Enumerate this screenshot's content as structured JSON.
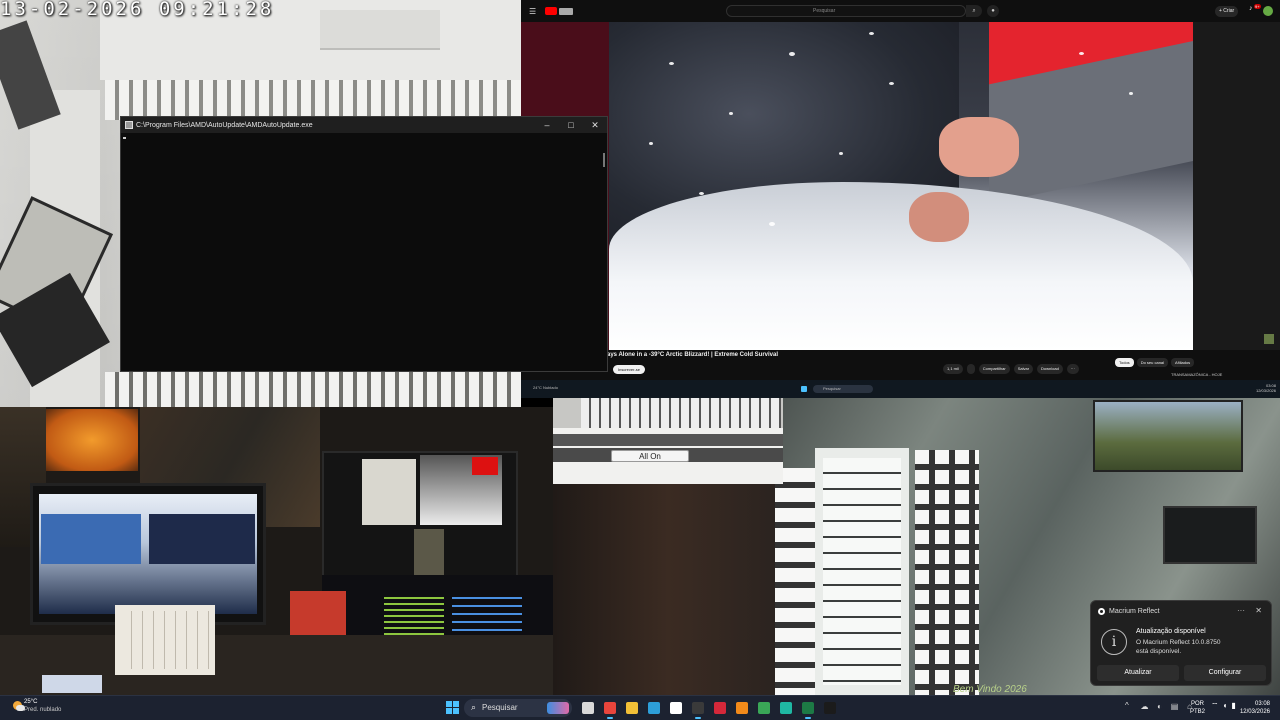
{
  "camera_top_left": {
    "timestamp": "13-02-2026 09:21:28"
  },
  "console_window": {
    "title": "C:\\Program Files\\AMD\\AutoUpdate\\AMDAutoUpdate.exe",
    "minimize": "–",
    "maximize": "□",
    "close": "✕"
  },
  "youtube": {
    "search_placeholder": "Pesquisar",
    "create_label": "+ Criar",
    "bell_badge": "9+",
    "video_title": "ays Alone in a -39°C Arctic Blizzard! | Extreme Cold Survival",
    "subscribe": "Inscrever-se",
    "actions": [
      "1,1 mil",
      "",
      "Compartilhar",
      "Salvar",
      "Download",
      "···"
    ],
    "chips": [
      "Todos",
      "Do seu canal",
      "Afiliados"
    ],
    "side_note": "TRANSAMAZÔNICA - HOJE"
  },
  "mini_taskbar": {
    "weather": "24°C Nublado",
    "search": "Pesquisar",
    "clock_time": "03:08",
    "clock_date": "12/03/2026"
  },
  "overlay_window": {
    "all_on_button": "All On"
  },
  "room_camera_right": {
    "welcome_text": "Bem Vindo 2026"
  },
  "toast": {
    "app_name": "Macrium Reflect",
    "more": "···",
    "close": "✕",
    "info_glyph": "i",
    "heading": "Atualização disponível",
    "message": "O Macrium Reflect 10.0.8750 está disponível.",
    "update_button": "Atualizar",
    "configure_button": "Configurar"
  },
  "taskbar": {
    "temperature": "25°C",
    "condition": "Pred. nublado",
    "search_label": "Pesquisar",
    "apps": [
      {
        "name": "task-view",
        "color": "#d9d9d9"
      },
      {
        "name": "chrome",
        "color": "#e8453c"
      },
      {
        "name": "file-explorer",
        "color": "#f2c037"
      },
      {
        "name": "edge",
        "color": "#2d9fd9"
      },
      {
        "name": "store",
        "color": "#ffffff"
      },
      {
        "name": "obs",
        "color": "#3a3a3a"
      },
      {
        "name": "app-red",
        "color": "#d4283a"
      },
      {
        "name": "vlc",
        "color": "#f28a1a"
      },
      {
        "name": "chrome-2",
        "color": "#3aa757"
      },
      {
        "name": "app-teal",
        "color": "#1fb8a3"
      },
      {
        "name": "excel",
        "color": "#1d7a45"
      },
      {
        "name": "app-terminal",
        "color": "#1b1b1b"
      }
    ],
    "tray_chevron": "^",
    "tray_icons": [
      "☁",
      "◐",
      "▤",
      "⌂"
    ],
    "lang_top": "POR",
    "lang_bottom": "PTB2",
    "sys_icons": [
      "⌔",
      "◖",
      "▮"
    ],
    "time": "03:08",
    "date": "12/03/2026"
  }
}
